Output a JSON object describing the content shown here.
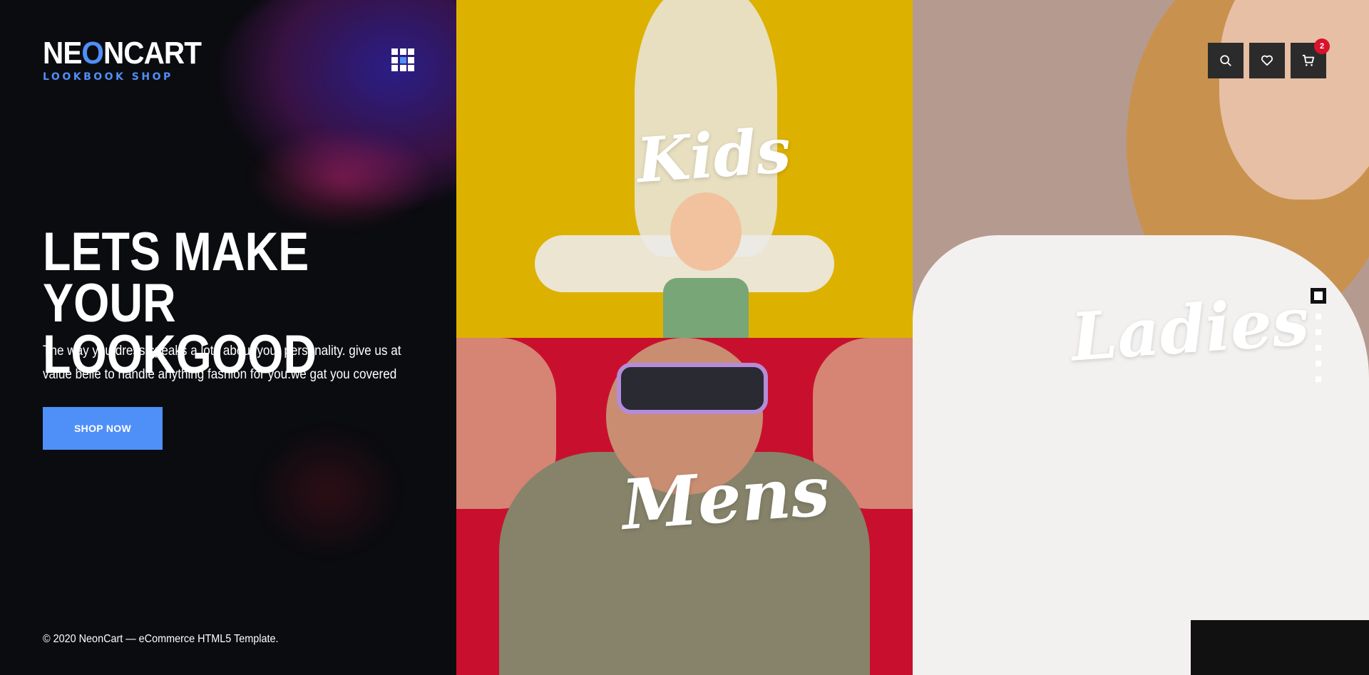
{
  "brand": {
    "name_pre": "NE",
    "name_o": "O",
    "name_post": "NCART",
    "tagline": "LOOKBOOK SHOP",
    "accent": "#4f8ff8"
  },
  "hero": {
    "headline_line1": "LETS MAKE YOUR",
    "headline_line2": "LOOKGOOD",
    "subtitle": "The way you dress speaks a lots about your personality. give us at value belle to handle anything fashion for you.we gat you covered",
    "cta": "SHOP NOW"
  },
  "footer": {
    "copyright": "© 2020 NeonCart — eCommerce HTML5 Template."
  },
  "categories": [
    {
      "label": "Kids",
      "color": "#ddb100"
    },
    {
      "label": "Mens",
      "color": "#c8102e"
    },
    {
      "label": "Ladies",
      "color": "#b59a8f"
    }
  ],
  "header_icons": [
    "search-icon",
    "heart-icon",
    "cart-icon"
  ],
  "cart": {
    "count": "2",
    "badge_color": "#d9122e"
  },
  "slider": {
    "total": 6,
    "active": 1
  }
}
